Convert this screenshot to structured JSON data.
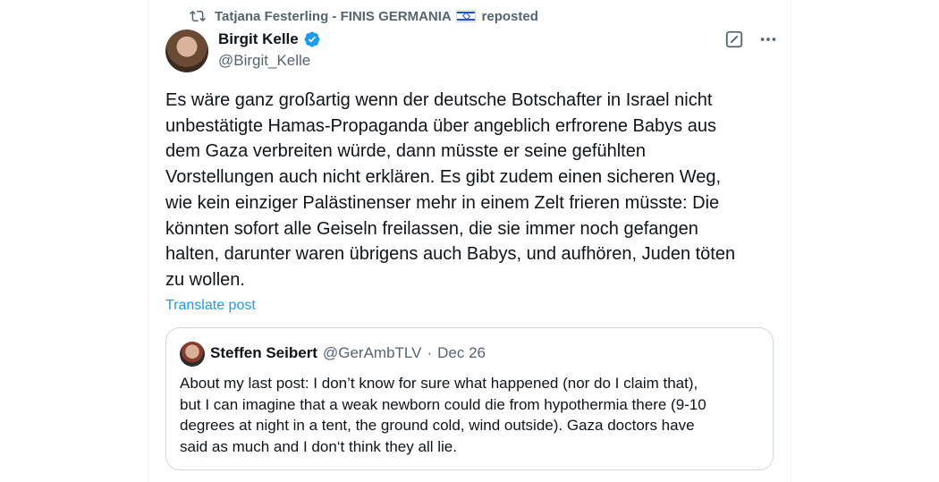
{
  "repost": {
    "reposter": "Tatjana Festerling - FINIS GERMANIA",
    "flag_icon": "israel-flag-icon",
    "suffix": "reposted"
  },
  "author": {
    "name": "Birgit Kelle",
    "handle": "@Birgit_Kelle",
    "verified_color": "#1d9bf0"
  },
  "post": {
    "text": "Es wäre ganz großartig wenn der deutsche Botschafter in Israel nicht\nunbestätigte Hamas-Propaganda über angeblich erfrorene Babys aus\ndem Gaza verbreiten würde, dann müsste er seine gefühlten\nVorstellungen auch nicht erklären. Es gibt zudem einen sicheren Weg,\nwie kein einziger Palästinenser mehr in einem Zelt frieren müsste: Die\nkönnten sofort alle Geiseln freilassen, die sie immer noch gefangen\nhalten, darunter waren übrigens auch Babys, und aufhören, Juden töten\nzu wollen.",
    "translate_label": "Translate post"
  },
  "quote": {
    "name": "Steffen Seibert",
    "handle": "@GerAmbTLV",
    "separator": "·",
    "date": "Dec 26",
    "text": "About my last post:  I don’t know for sure what happened (nor do I claim that),\nbut I can imagine that a weak newborn could die from hypothermia there (9-10\ndegrees at night in a tent, the ground cold, wind outside). Gaza doctors have\nsaid as much and I don‘t think they all lie."
  },
  "icons": {
    "repost": "repost-icon",
    "verified": "verified-badge-icon",
    "grok": "grok-icon",
    "more": "more-options-icon"
  },
  "colors": {
    "accent": "#1d9bf0",
    "secondary_text": "#536471",
    "border": "#cfd9de"
  }
}
